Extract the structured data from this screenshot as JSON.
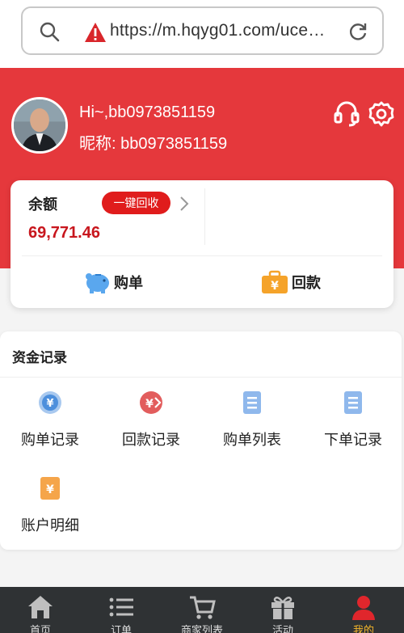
{
  "browser": {
    "url": "https://m.hqyg01.com/uce…",
    "icons": [
      "search-icon",
      "warning-icon",
      "reload-icon"
    ]
  },
  "user": {
    "greeting": "Hi~,bb0973851159",
    "nickname": "昵称: bb0973851159"
  },
  "header_icons": [
    "customer-service-icon",
    "settings-icon"
  ],
  "balance": {
    "label": "余额",
    "withdraw_button": "一键回收",
    "amount": "69,771.46"
  },
  "actions": {
    "buy": "购单",
    "return": "回款"
  },
  "records": {
    "title": "资金记录",
    "items": [
      {
        "label": "购单记录",
        "icon": "yen-coin-icon"
      },
      {
        "label": "回款记录",
        "icon": "yen-return-icon"
      },
      {
        "label": "购单列表",
        "icon": "list-doc-icon"
      },
      {
        "label": "下单记录",
        "icon": "list-doc-icon"
      },
      {
        "label": "账户明细",
        "icon": "yen-doc-icon"
      }
    ]
  },
  "nav": [
    {
      "label": "首页",
      "icon": "home-icon"
    },
    {
      "label": "订单",
      "icon": "list-icon"
    },
    {
      "label": "商家列表",
      "icon": "cart-icon"
    },
    {
      "label": "活动",
      "icon": "gift-icon"
    },
    {
      "label": "我的",
      "icon": "user-icon",
      "active": true
    }
  ],
  "colors": {
    "header_red": "#e5383c",
    "button_red": "#e01c1c",
    "amount_red": "#c8161d",
    "nav_bg": "#2f3234",
    "nav_active": "#f5b62a"
  }
}
